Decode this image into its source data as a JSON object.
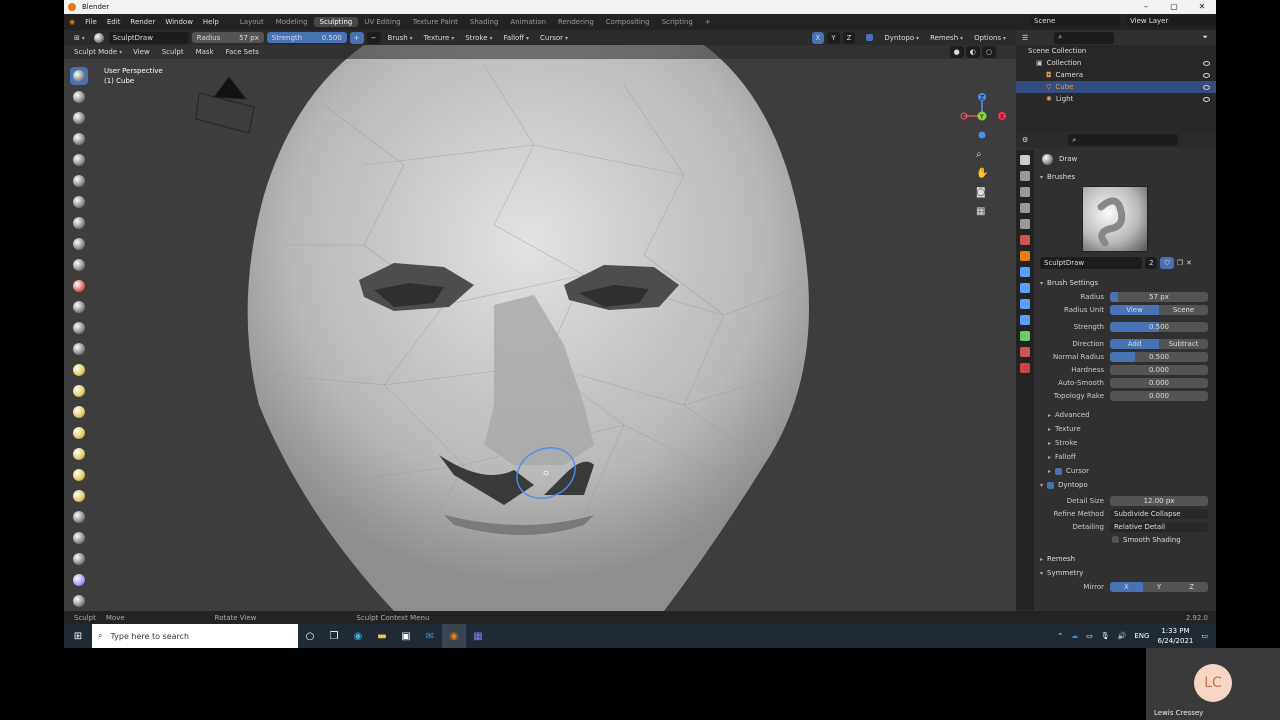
{
  "window": {
    "title": "Blender",
    "controls": [
      "–",
      "▢",
      "✕"
    ]
  },
  "menu": {
    "items": [
      "File",
      "Edit",
      "Render",
      "Window",
      "Help"
    ],
    "workspaces": [
      "Layout",
      "Modeling",
      "Sculpting",
      "UV Editing",
      "Texture Paint",
      "Shading",
      "Animation",
      "Rendering",
      "Compositing",
      "Scripting",
      "+"
    ],
    "active_workspace": "Sculpting",
    "scene": "Scene",
    "view_layer": "View Layer"
  },
  "tool_header": {
    "brush": "SculptDraw",
    "radius_label": "Radius",
    "radius_value": "57 px",
    "strength_label": "Strength",
    "strength_value": "0.500",
    "menus": [
      "Brush",
      "Texture",
      "Stroke",
      "Falloff",
      "Cursor"
    ],
    "axes": [
      "X",
      "Y",
      "Z"
    ],
    "right_menus": [
      "Dyntopo",
      "Remesh",
      "Options"
    ]
  },
  "viewport_header": {
    "mode": "Sculpt Mode",
    "menus": [
      "View",
      "Sculpt",
      "Mask",
      "Face Sets"
    ]
  },
  "viewport": {
    "perspective": "User Perspective",
    "object": "(1) Cube",
    "gizmo_axes": [
      "X",
      "Y",
      "Z"
    ]
  },
  "outliner": {
    "root": "Scene Collection",
    "items": [
      {
        "label": "Collection",
        "selected": false
      },
      {
        "label": "Camera",
        "selected": false
      },
      {
        "label": "Cube",
        "selected": true
      },
      {
        "label": "Light",
        "selected": false
      }
    ]
  },
  "properties": {
    "tool": "Draw",
    "brushes_section": "Brushes",
    "brush_name": "SculptDraw",
    "brush_users": "2",
    "brush_settings_section": "Brush Settings",
    "radius": {
      "label": "Radius",
      "value": "57 px"
    },
    "radius_unit": {
      "label": "Radius Unit",
      "options": [
        "View",
        "Scene"
      ],
      "active": "View"
    },
    "strength": {
      "label": "Strength",
      "value": "0.500",
      "fill": 0.5
    },
    "direction": {
      "label": "Direction",
      "options": [
        "Add",
        "Subtract"
      ],
      "active": "Add"
    },
    "normal_radius": {
      "label": "Normal Radius",
      "value": "0.500",
      "fill": 0.5
    },
    "hardness": {
      "label": "Hardness",
      "value": "0.000"
    },
    "auto_smooth": {
      "label": "Auto-Smooth",
      "value": "0.000"
    },
    "topology_rake": {
      "label": "Topology Rake",
      "value": "0.000"
    },
    "subsections": [
      "Advanced",
      "Texture",
      "Stroke",
      "Falloff"
    ],
    "cursor": "Cursor",
    "dyntopo_section": "Dyntopo",
    "detail_size": {
      "label": "Detail Size",
      "value": "12.00 px"
    },
    "refine_method": {
      "label": "Refine Method",
      "value": "Subdivide Collapse"
    },
    "detailing": {
      "label": "Detailing",
      "value": "Relative Detail"
    },
    "smooth_shading": "Smooth Shading",
    "remesh_section": "Remesh",
    "symmetry_section": "Symmetry",
    "mirror": {
      "label": "Mirror",
      "options": [
        "X",
        "Y",
        "Z"
      ],
      "active": "X"
    },
    "version": "2.92.0"
  },
  "statusbar": {
    "items": [
      "Sculpt",
      "Move",
      "Rotate View",
      "Sculpt Context Menu"
    ]
  },
  "taskbar": {
    "search_placeholder": "Type here to search",
    "language": "ENG",
    "time": "1:33 PM",
    "date": "6/24/2021"
  },
  "participant": {
    "initials": "LC",
    "name": "Lewis Cressey"
  },
  "colors": {
    "accent": "#4772b3",
    "selection": "#334d80",
    "blender_orange": "#e87d0d"
  }
}
